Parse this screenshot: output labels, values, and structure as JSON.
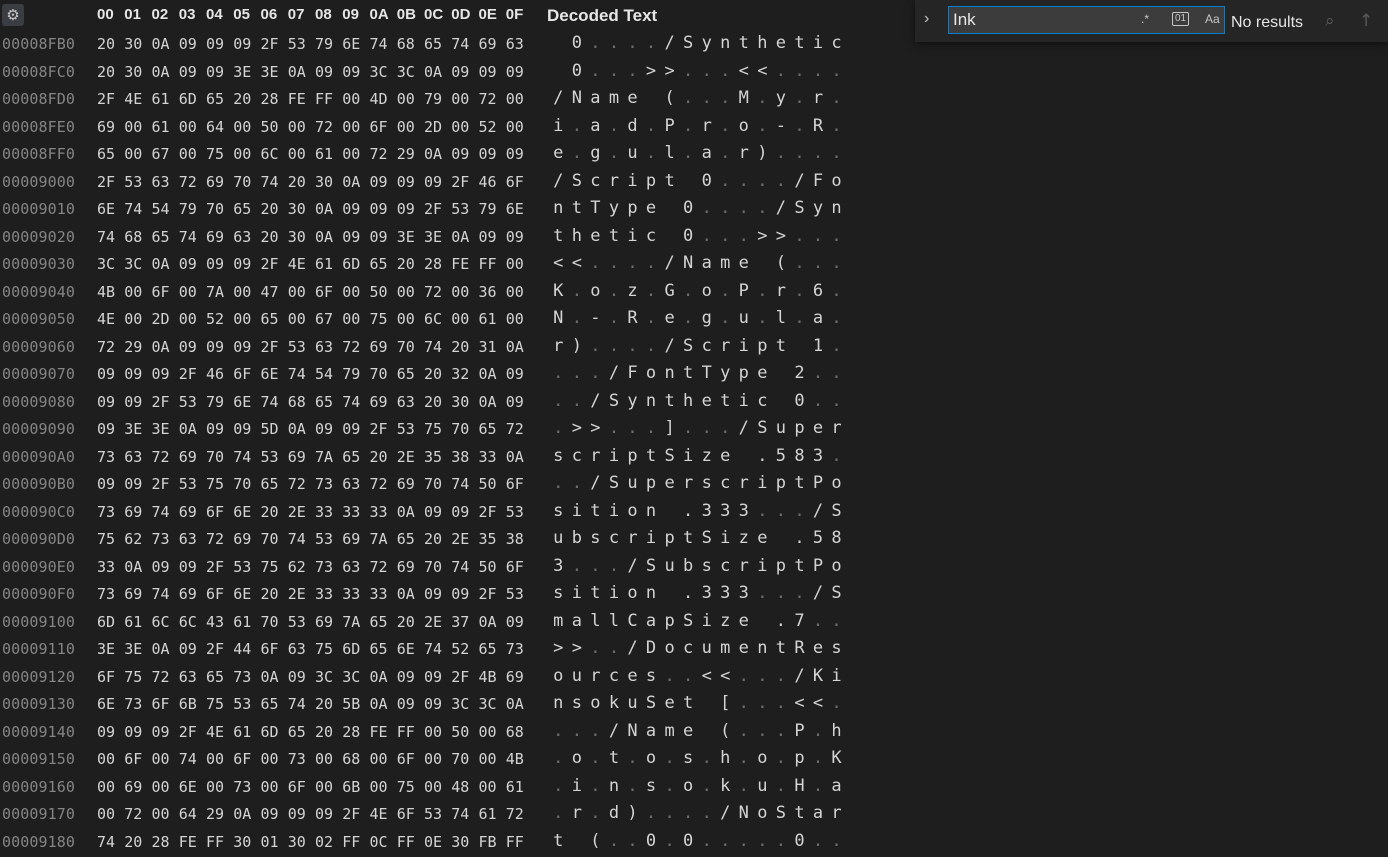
{
  "header": {
    "hex_columns": [
      "00",
      "01",
      "02",
      "03",
      "04",
      "05",
      "06",
      "07",
      "08",
      "09",
      "0A",
      "0B",
      "0C",
      "0D",
      "0E",
      "0F"
    ],
    "decoded_label": "Decoded Text"
  },
  "settings_icon": "gear-icon",
  "find": {
    "value": "Ink",
    "results": "No results",
    "expand_icon": "chevron-right-icon",
    "regex_icon": "regex-icon",
    "binary_icon": "binary-icon",
    "case_icon": "match-case-icon",
    "find_all_icon": "search-all-icon",
    "previous_icon": "arrow-up-icon"
  },
  "rows": [
    {
      "addr": "00008FB0",
      "hex": [
        "20",
        "30",
        "0A",
        "09",
        "09",
        "09",
        "2F",
        "53",
        "79",
        "6E",
        "74",
        "68",
        "65",
        "74",
        "69",
        "63"
      ],
      "dec": [
        " ",
        "0",
        ".",
        ".",
        ".",
        ".",
        "/",
        "S",
        "y",
        "n",
        "t",
        "h",
        "e",
        "t",
        "i",
        "c"
      ]
    },
    {
      "addr": "00008FC0",
      "hex": [
        "20",
        "30",
        "0A",
        "09",
        "09",
        "3E",
        "3E",
        "0A",
        "09",
        "09",
        "3C",
        "3C",
        "0A",
        "09",
        "09",
        "09"
      ],
      "dec": [
        " ",
        "0",
        ".",
        ".",
        ".",
        ">",
        ">",
        ".",
        ".",
        ".",
        "<",
        "<",
        ".",
        ".",
        ".",
        "."
      ]
    },
    {
      "addr": "00008FD0",
      "hex": [
        "2F",
        "4E",
        "61",
        "6D",
        "65",
        "20",
        "28",
        "FE",
        "FF",
        "00",
        "4D",
        "00",
        "79",
        "00",
        "72",
        "00"
      ],
      "dec": [
        "/",
        "N",
        "a",
        "m",
        "e",
        " ",
        "(",
        ".",
        ".",
        ".",
        "M",
        ".",
        "y",
        ".",
        "r",
        "."
      ]
    },
    {
      "addr": "00008FE0",
      "hex": [
        "69",
        "00",
        "61",
        "00",
        "64",
        "00",
        "50",
        "00",
        "72",
        "00",
        "6F",
        "00",
        "2D",
        "00",
        "52",
        "00"
      ],
      "dec": [
        "i",
        ".",
        "a",
        ".",
        "d",
        ".",
        "P",
        ".",
        "r",
        ".",
        "o",
        ".",
        "-",
        ".",
        "R",
        "."
      ]
    },
    {
      "addr": "00008FF0",
      "hex": [
        "65",
        "00",
        "67",
        "00",
        "75",
        "00",
        "6C",
        "00",
        "61",
        "00",
        "72",
        "29",
        "0A",
        "09",
        "09",
        "09"
      ],
      "dec": [
        "e",
        ".",
        "g",
        ".",
        "u",
        ".",
        "l",
        ".",
        "a",
        ".",
        "r",
        ")",
        ".",
        ".",
        ".",
        "."
      ]
    },
    {
      "addr": "00009000",
      "hex": [
        "2F",
        "53",
        "63",
        "72",
        "69",
        "70",
        "74",
        "20",
        "30",
        "0A",
        "09",
        "09",
        "09",
        "2F",
        "46",
        "6F"
      ],
      "dec": [
        "/",
        "S",
        "c",
        "r",
        "i",
        "p",
        "t",
        " ",
        "0",
        ".",
        ".",
        ".",
        ".",
        "/",
        "F",
        "o"
      ]
    },
    {
      "addr": "00009010",
      "hex": [
        "6E",
        "74",
        "54",
        "79",
        "70",
        "65",
        "20",
        "30",
        "0A",
        "09",
        "09",
        "09",
        "2F",
        "53",
        "79",
        "6E"
      ],
      "dec": [
        "n",
        "t",
        "T",
        "y",
        "p",
        "e",
        " ",
        "0",
        ".",
        ".",
        ".",
        ".",
        "/",
        "S",
        "y",
        "n"
      ]
    },
    {
      "addr": "00009020",
      "hex": [
        "74",
        "68",
        "65",
        "74",
        "69",
        "63",
        "20",
        "30",
        "0A",
        "09",
        "09",
        "3E",
        "3E",
        "0A",
        "09",
        "09"
      ],
      "dec": [
        "t",
        "h",
        "e",
        "t",
        "i",
        "c",
        " ",
        "0",
        ".",
        ".",
        ".",
        ">",
        ">",
        ".",
        ".",
        "."
      ]
    },
    {
      "addr": "00009030",
      "hex": [
        "3C",
        "3C",
        "0A",
        "09",
        "09",
        "09",
        "2F",
        "4E",
        "61",
        "6D",
        "65",
        "20",
        "28",
        "FE",
        "FF",
        "00"
      ],
      "dec": [
        "<",
        "<",
        ".",
        ".",
        ".",
        ".",
        "/",
        "N",
        "a",
        "m",
        "e",
        " ",
        "(",
        ".",
        ".",
        "."
      ]
    },
    {
      "addr": "00009040",
      "hex": [
        "4B",
        "00",
        "6F",
        "00",
        "7A",
        "00",
        "47",
        "00",
        "6F",
        "00",
        "50",
        "00",
        "72",
        "00",
        "36",
        "00"
      ],
      "dec": [
        "K",
        ".",
        "o",
        ".",
        "z",
        ".",
        "G",
        ".",
        "o",
        ".",
        "P",
        ".",
        "r",
        ".",
        "6",
        "."
      ]
    },
    {
      "addr": "00009050",
      "hex": [
        "4E",
        "00",
        "2D",
        "00",
        "52",
        "00",
        "65",
        "00",
        "67",
        "00",
        "75",
        "00",
        "6C",
        "00",
        "61",
        "00"
      ],
      "dec": [
        "N",
        ".",
        "-",
        ".",
        "R",
        ".",
        "e",
        ".",
        "g",
        ".",
        "u",
        ".",
        "l",
        ".",
        "a",
        "."
      ]
    },
    {
      "addr": "00009060",
      "hex": [
        "72",
        "29",
        "0A",
        "09",
        "09",
        "09",
        "2F",
        "53",
        "63",
        "72",
        "69",
        "70",
        "74",
        "20",
        "31",
        "0A"
      ],
      "dec": [
        "r",
        ")",
        ".",
        ".",
        ".",
        ".",
        "/",
        "S",
        "c",
        "r",
        "i",
        "p",
        "t",
        " ",
        "1",
        "."
      ]
    },
    {
      "addr": "00009070",
      "hex": [
        "09",
        "09",
        "09",
        "2F",
        "46",
        "6F",
        "6E",
        "74",
        "54",
        "79",
        "70",
        "65",
        "20",
        "32",
        "0A",
        "09"
      ],
      "dec": [
        ".",
        ".",
        ".",
        "/",
        "F",
        "o",
        "n",
        "t",
        "T",
        "y",
        "p",
        "e",
        " ",
        "2",
        ".",
        "."
      ]
    },
    {
      "addr": "00009080",
      "hex": [
        "09",
        "09",
        "2F",
        "53",
        "79",
        "6E",
        "74",
        "68",
        "65",
        "74",
        "69",
        "63",
        "20",
        "30",
        "0A",
        "09"
      ],
      "dec": [
        ".",
        ".",
        "/",
        "S",
        "y",
        "n",
        "t",
        "h",
        "e",
        "t",
        "i",
        "c",
        " ",
        "0",
        ".",
        "."
      ]
    },
    {
      "addr": "00009090",
      "hex": [
        "09",
        "3E",
        "3E",
        "0A",
        "09",
        "09",
        "5D",
        "0A",
        "09",
        "09",
        "2F",
        "53",
        "75",
        "70",
        "65",
        "72"
      ],
      "dec": [
        ".",
        ">",
        ">",
        ".",
        ".",
        ".",
        "]",
        ".",
        ".",
        ".",
        "/",
        "S",
        "u",
        "p",
        "e",
        "r"
      ]
    },
    {
      "addr": "000090A0",
      "hex": [
        "73",
        "63",
        "72",
        "69",
        "70",
        "74",
        "53",
        "69",
        "7A",
        "65",
        "20",
        "2E",
        "35",
        "38",
        "33",
        "0A"
      ],
      "dec": [
        "s",
        "c",
        "r",
        "i",
        "p",
        "t",
        "S",
        "i",
        "z",
        "e",
        " ",
        ".",
        "5",
        "8",
        "3",
        "."
      ]
    },
    {
      "addr": "000090B0",
      "hex": [
        "09",
        "09",
        "2F",
        "53",
        "75",
        "70",
        "65",
        "72",
        "73",
        "63",
        "72",
        "69",
        "70",
        "74",
        "50",
        "6F"
      ],
      "dec": [
        ".",
        ".",
        "/",
        "S",
        "u",
        "p",
        "e",
        "r",
        "s",
        "c",
        "r",
        "i",
        "p",
        "t",
        "P",
        "o"
      ]
    },
    {
      "addr": "000090C0",
      "hex": [
        "73",
        "69",
        "74",
        "69",
        "6F",
        "6E",
        "20",
        "2E",
        "33",
        "33",
        "33",
        "0A",
        "09",
        "09",
        "2F",
        "53"
      ],
      "dec": [
        "s",
        "i",
        "t",
        "i",
        "o",
        "n",
        " ",
        ".",
        "3",
        "3",
        "3",
        ".",
        ".",
        ".",
        "/",
        "S"
      ]
    },
    {
      "addr": "000090D0",
      "hex": [
        "75",
        "62",
        "73",
        "63",
        "72",
        "69",
        "70",
        "74",
        "53",
        "69",
        "7A",
        "65",
        "20",
        "2E",
        "35",
        "38"
      ],
      "dec": [
        "u",
        "b",
        "s",
        "c",
        "r",
        "i",
        "p",
        "t",
        "S",
        "i",
        "z",
        "e",
        " ",
        ".",
        "5",
        "8"
      ]
    },
    {
      "addr": "000090E0",
      "hex": [
        "33",
        "0A",
        "09",
        "09",
        "2F",
        "53",
        "75",
        "62",
        "73",
        "63",
        "72",
        "69",
        "70",
        "74",
        "50",
        "6F"
      ],
      "dec": [
        "3",
        ".",
        ".",
        ".",
        "/",
        "S",
        "u",
        "b",
        "s",
        "c",
        "r",
        "i",
        "p",
        "t",
        "P",
        "o"
      ]
    },
    {
      "addr": "000090F0",
      "hex": [
        "73",
        "69",
        "74",
        "69",
        "6F",
        "6E",
        "20",
        "2E",
        "33",
        "33",
        "33",
        "0A",
        "09",
        "09",
        "2F",
        "53"
      ],
      "dec": [
        "s",
        "i",
        "t",
        "i",
        "o",
        "n",
        " ",
        ".",
        "3",
        "3",
        "3",
        ".",
        ".",
        ".",
        "/",
        "S"
      ]
    },
    {
      "addr": "00009100",
      "hex": [
        "6D",
        "61",
        "6C",
        "6C",
        "43",
        "61",
        "70",
        "53",
        "69",
        "7A",
        "65",
        "20",
        "2E",
        "37",
        "0A",
        "09"
      ],
      "dec": [
        "m",
        "a",
        "l",
        "l",
        "C",
        "a",
        "p",
        "S",
        "i",
        "z",
        "e",
        " ",
        ".",
        "7",
        ".",
        "."
      ]
    },
    {
      "addr": "00009110",
      "hex": [
        "3E",
        "3E",
        "0A",
        "09",
        "2F",
        "44",
        "6F",
        "63",
        "75",
        "6D",
        "65",
        "6E",
        "74",
        "52",
        "65",
        "73"
      ],
      "dec": [
        ">",
        ">",
        ".",
        ".",
        "/",
        "D",
        "o",
        "c",
        "u",
        "m",
        "e",
        "n",
        "t",
        "R",
        "e",
        "s"
      ]
    },
    {
      "addr": "00009120",
      "hex": [
        "6F",
        "75",
        "72",
        "63",
        "65",
        "73",
        "0A",
        "09",
        "3C",
        "3C",
        "0A",
        "09",
        "09",
        "2F",
        "4B",
        "69"
      ],
      "dec": [
        "o",
        "u",
        "r",
        "c",
        "e",
        "s",
        ".",
        ".",
        "<",
        "<",
        ".",
        ".",
        ".",
        "/",
        "K",
        "i"
      ]
    },
    {
      "addr": "00009130",
      "hex": [
        "6E",
        "73",
        "6F",
        "6B",
        "75",
        "53",
        "65",
        "74",
        "20",
        "5B",
        "0A",
        "09",
        "09",
        "3C",
        "3C",
        "0A"
      ],
      "dec": [
        "n",
        "s",
        "o",
        "k",
        "u",
        "S",
        "e",
        "t",
        " ",
        "[",
        ".",
        ".",
        ".",
        "<",
        "<",
        "."
      ]
    },
    {
      "addr": "00009140",
      "hex": [
        "09",
        "09",
        "09",
        "2F",
        "4E",
        "61",
        "6D",
        "65",
        "20",
        "28",
        "FE",
        "FF",
        "00",
        "50",
        "00",
        "68"
      ],
      "dec": [
        ".",
        ".",
        ".",
        "/",
        "N",
        "a",
        "m",
        "e",
        " ",
        "(",
        ".",
        ".",
        ".",
        "P",
        ".",
        "h"
      ]
    },
    {
      "addr": "00009150",
      "hex": [
        "00",
        "6F",
        "00",
        "74",
        "00",
        "6F",
        "00",
        "73",
        "00",
        "68",
        "00",
        "6F",
        "00",
        "70",
        "00",
        "4B"
      ],
      "dec": [
        ".",
        "o",
        ".",
        "t",
        ".",
        "o",
        ".",
        "s",
        ".",
        "h",
        ".",
        "o",
        ".",
        "p",
        ".",
        "K"
      ]
    },
    {
      "addr": "00009160",
      "hex": [
        "00",
        "69",
        "00",
        "6E",
        "00",
        "73",
        "00",
        "6F",
        "00",
        "6B",
        "00",
        "75",
        "00",
        "48",
        "00",
        "61"
      ],
      "dec": [
        ".",
        "i",
        ".",
        "n",
        ".",
        "s",
        ".",
        "o",
        ".",
        "k",
        ".",
        "u",
        ".",
        "H",
        ".",
        "a"
      ]
    },
    {
      "addr": "00009170",
      "hex": [
        "00",
        "72",
        "00",
        "64",
        "29",
        "0A",
        "09",
        "09",
        "09",
        "2F",
        "4E",
        "6F",
        "53",
        "74",
        "61",
        "72"
      ],
      "dec": [
        ".",
        "r",
        ".",
        "d",
        ")",
        ".",
        ".",
        ".",
        ".",
        "/",
        "N",
        "o",
        "S",
        "t",
        "a",
        "r"
      ]
    },
    {
      "addr": "00009180",
      "hex": [
        "74",
        "20",
        "28",
        "FE",
        "FF",
        "30",
        "01",
        "30",
        "02",
        "FF",
        "0C",
        "FF",
        "0E",
        "30",
        "FB",
        "FF"
      ],
      "dec": [
        "t",
        " ",
        "(",
        ".",
        ".",
        "0",
        ".",
        "0",
        ".",
        ".",
        ".",
        ".",
        ".",
        "0",
        ".",
        "."
      ]
    }
  ]
}
